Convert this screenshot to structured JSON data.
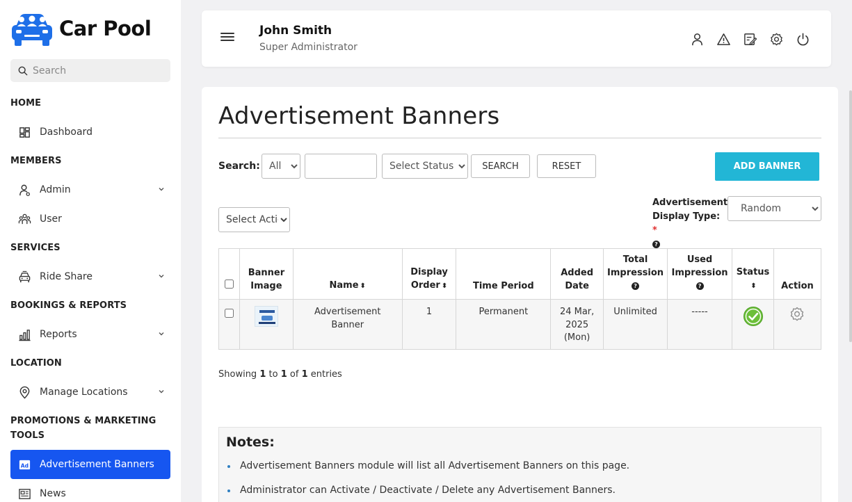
{
  "brand": {
    "name": "Car Pool",
    "logo_icon": "car-pool-logo"
  },
  "sidebar": {
    "search_placeholder": "Search",
    "sections": {
      "home": "HOME",
      "members": "MEMBERS",
      "services": "SERVICES",
      "bookings": "BOOKINGS & REPORTS",
      "location": "LOCATION",
      "promotions_line1": "PROMOTIONS & MARKETING",
      "promotions_line2": "TOOLS"
    },
    "items": {
      "dashboard": "Dashboard",
      "admin": "Admin",
      "user": "User",
      "ride_share": "Ride Share",
      "reports": "Reports",
      "manage_locations": "Manage Locations",
      "advertisement_banners": "Advertisement Banners",
      "news": "News"
    },
    "active_color": "#1656f0"
  },
  "header": {
    "user_name": "John Smith",
    "user_role": "Super Administrator",
    "icons": [
      "user-icon",
      "alert-triangle-icon",
      "edit-note-icon",
      "settings-icon",
      "power-icon"
    ]
  },
  "page": {
    "title": "Advertisement Banners",
    "search_label": "Search:",
    "search_scope_value": "All",
    "status_select_value": "Select Status",
    "search_button": "SEARCH",
    "reset_button": "RESET",
    "add_button": "ADD BANNER",
    "add_button_color": "#22b6d6",
    "action_select_value": "Select Action",
    "display_type_label_line1": "Advertisement",
    "display_type_label_line2": "Display Type:",
    "required_mark": "*",
    "display_type_value": "Random"
  },
  "table": {
    "headers": {
      "banner_image_1": "Banner",
      "banner_image_2": "Image",
      "name": "Name",
      "display_order_1": "Display",
      "display_order_2": "Order",
      "time_period": "Time Period",
      "added_date_1": "Added",
      "added_date_2": "Date",
      "total_impression_1": "Total",
      "total_impression_2": "Impression",
      "used_impression_1": "Used",
      "used_impression_2": "Impression",
      "status": "Status",
      "action": "Action"
    },
    "rows": [
      {
        "name_1": "Advertisement",
        "name_2": "Banner",
        "display_order": "1",
        "time_period": "Permanent",
        "added_date_1": "24 Mar,",
        "added_date_2": "2025",
        "added_date_3": "(Mon)",
        "total_impression": "Unlimited",
        "used_impression": "-----",
        "status": "active"
      }
    ]
  },
  "pagination": {
    "prefix": "Showing",
    "from": "1",
    "to_word": "to",
    "to": "1",
    "of_word": "of",
    "total": "1",
    "suffix": "entries"
  },
  "notes": {
    "title": "Notes:",
    "items": [
      "Advertisement Banners module will list all Advertisement Banners on this page.",
      "Administrator can Activate / Deactivate / Delete any Advertisement Banners."
    ]
  }
}
